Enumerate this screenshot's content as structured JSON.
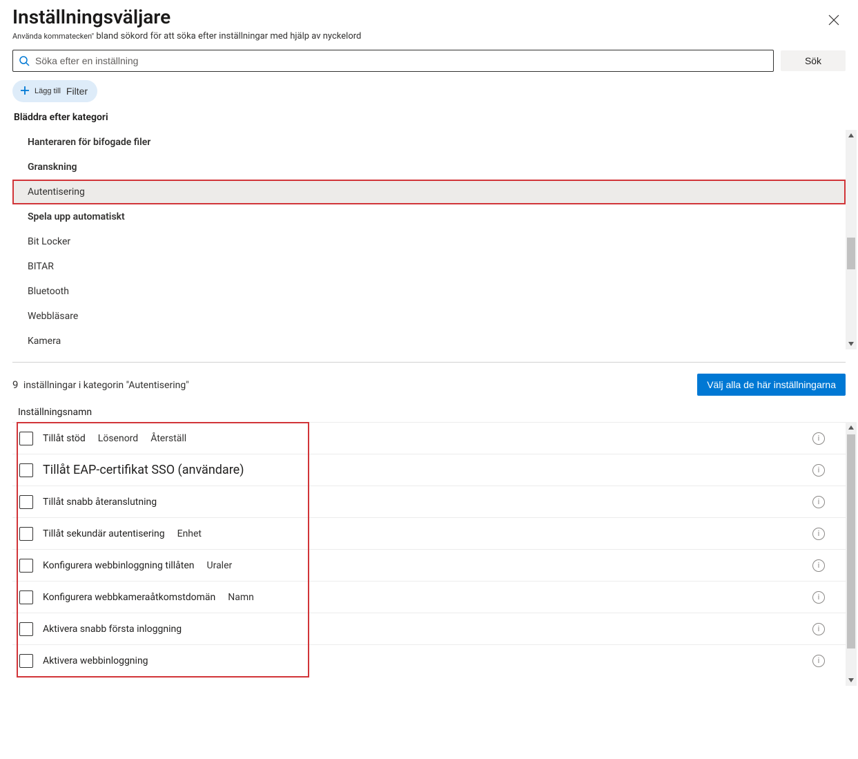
{
  "header": {
    "title": "Inställningsväljare",
    "subtitle_small": "Använda kommatecken\"",
    "subtitle_rest": " bland sökord för att söka efter inställningar med hjälp av nyckelord"
  },
  "search": {
    "placeholder": "Söka efter en inställning",
    "button": "Sök"
  },
  "filter_pill": {
    "small": "Lägg till",
    "label": "Filter"
  },
  "browse_label": "Bläddra efter kategori",
  "categories": [
    {
      "label": "Hanteraren för bifogade filer",
      "bold": true
    },
    {
      "label": "Granskning",
      "bold": true
    },
    {
      "label": "Autentisering",
      "bold": false,
      "selected": true,
      "highlighted": true
    },
    {
      "label": "Spela upp automatiskt",
      "bold": true
    },
    {
      "label": "Bit Locker",
      "bold": false
    },
    {
      "label": "BITAR",
      "bold": false
    },
    {
      "label": "Bluetooth",
      "bold": false
    },
    {
      "label": "Webbläsare",
      "bold": false
    },
    {
      "label": "Kamera",
      "bold": false
    }
  ],
  "results": {
    "count": "9",
    "count_rest": "inställningar i kategorin \"Autentisering\"",
    "select_all": "Välj alla de här inställningarna",
    "column_header": "Inställningsnamn"
  },
  "settings": [
    {
      "name": "Tillåt stöd",
      "extras": [
        "Lösenord",
        "Återställ"
      ]
    },
    {
      "name": "Tillåt EAP-certifikat SSO (användare)",
      "large": true
    },
    {
      "name": "Tillåt snabb återanslutning"
    },
    {
      "name": "Tillåt sekundär autentisering",
      "extras": [
        "Enhet"
      ]
    },
    {
      "name": "Konfigurera webbinloggning tillåten",
      "extras": [
        "Uraler"
      ]
    },
    {
      "name": "Konfigurera webbkameraåtkomstdomän",
      "extras": [
        "Namn"
      ]
    },
    {
      "name": "Aktivera snabb första inloggning"
    },
    {
      "name": "Aktivera webbinloggning"
    }
  ],
  "info_glyph": "i"
}
